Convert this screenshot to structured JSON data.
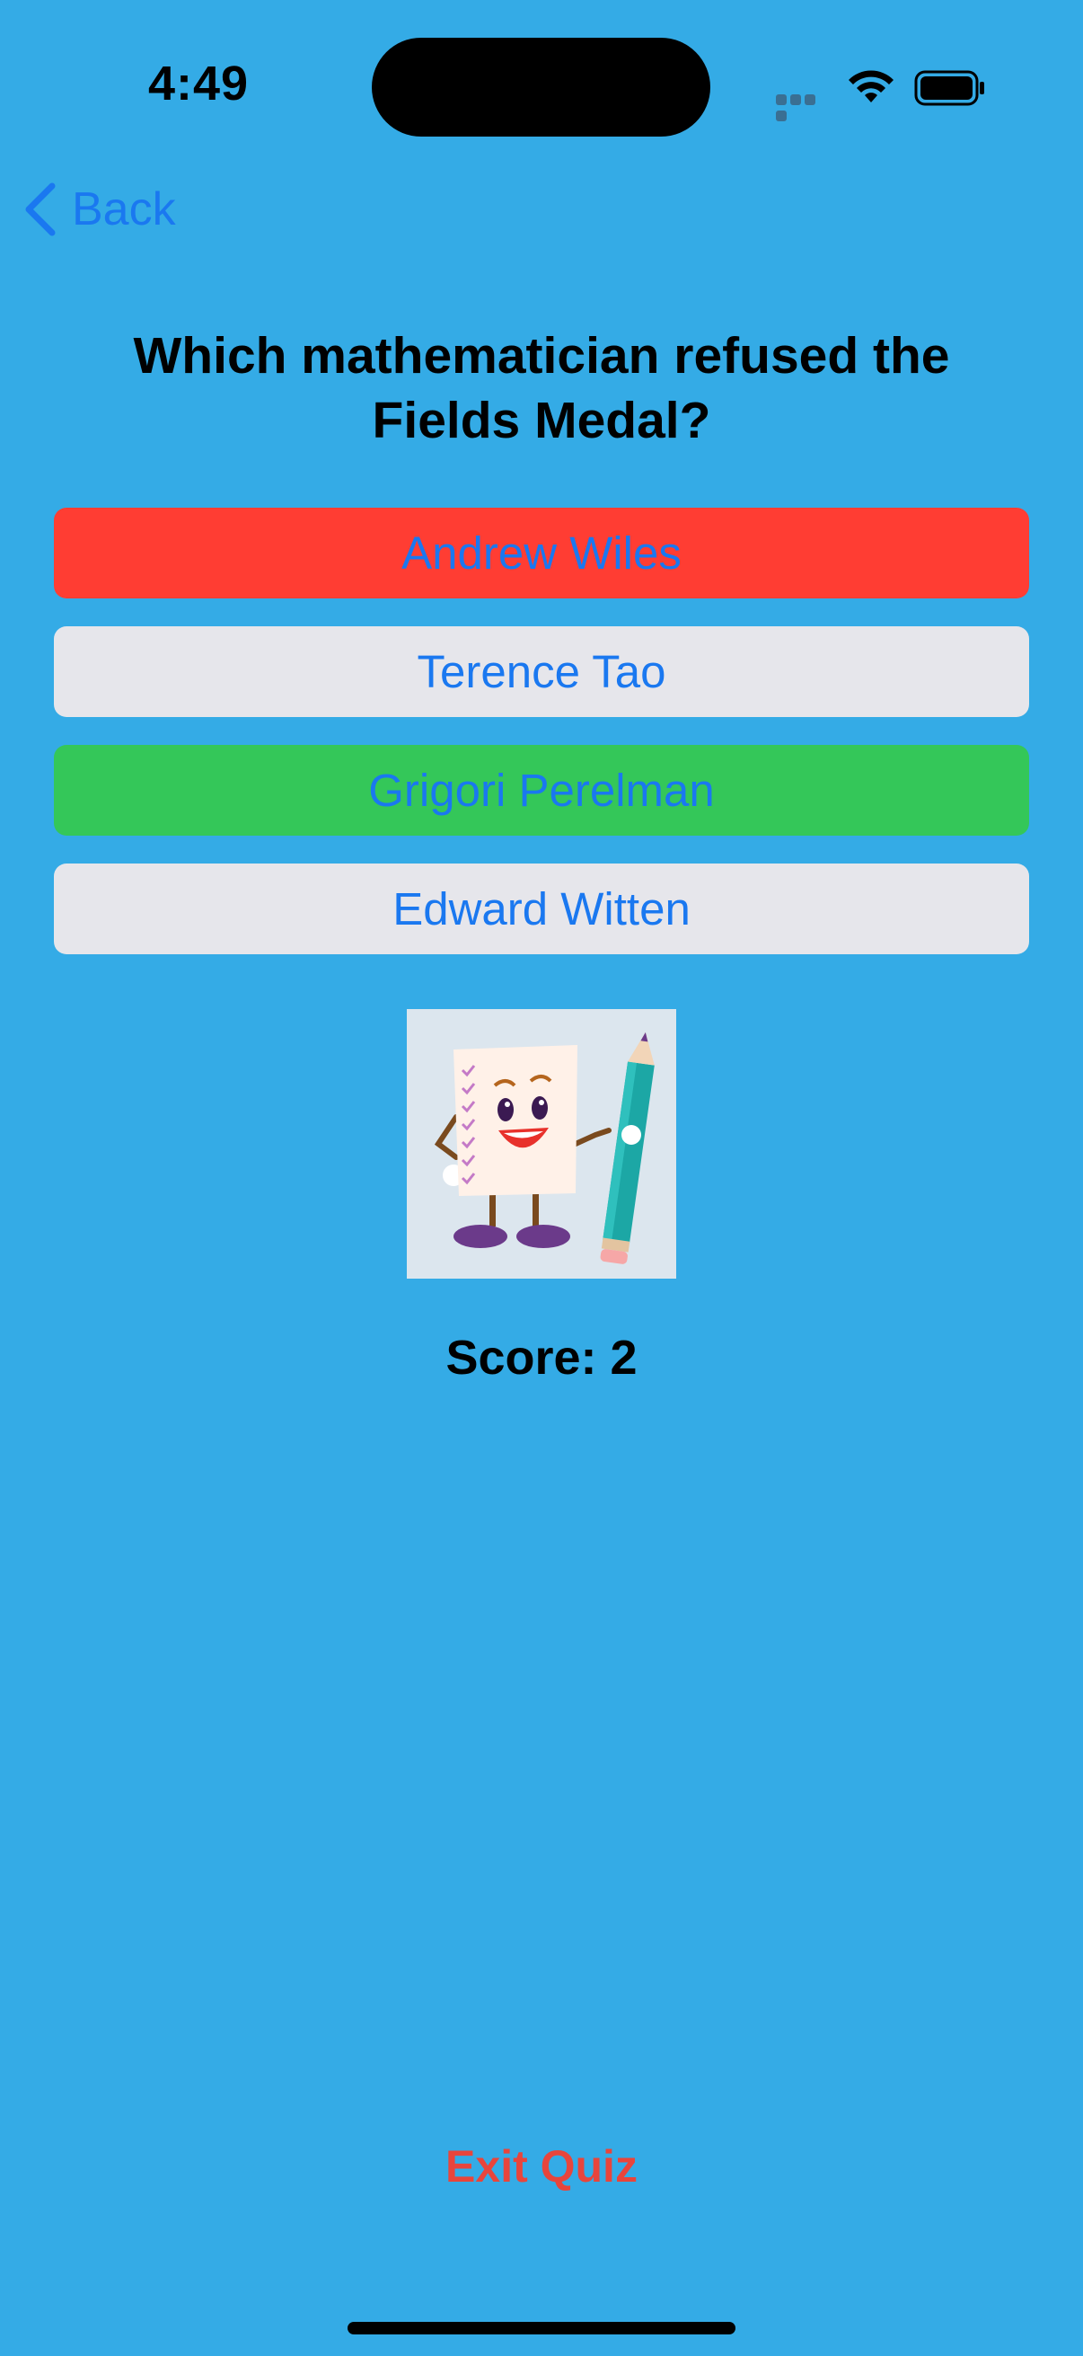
{
  "status": {
    "time": "4:49"
  },
  "nav": {
    "back_label": "Back"
  },
  "quiz": {
    "question": "Which mathematician refused the Fields Medal?",
    "answers": [
      {
        "label": "Andrew Wiles",
        "state": "incorrect"
      },
      {
        "label": "Terence Tao",
        "state": "neutral"
      },
      {
        "label": "Grigori Perelman",
        "state": "correct"
      },
      {
        "label": "Edward Witten",
        "state": "neutral"
      }
    ],
    "score_text": "Score: 2",
    "exit_label": "Exit Quiz",
    "mascot_icon": "smiling-paper-with-pencil-icon"
  },
  "colors": {
    "background": "#34ABE6",
    "link": "#1A78F0",
    "incorrect": "#FF3D33",
    "correct": "#34C759",
    "neutral": "#E6E6EB",
    "exit": "#E8453C"
  }
}
